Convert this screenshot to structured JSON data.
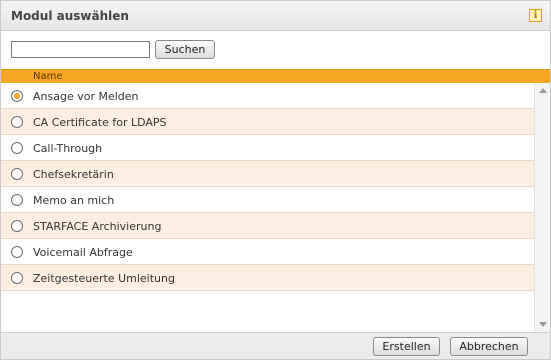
{
  "dialog": {
    "title": "Modul auswählen",
    "info_icon": "info-icon"
  },
  "search": {
    "value": "",
    "placeholder": "",
    "button_label": "Suchen"
  },
  "table": {
    "column_header": "Name",
    "selected_index": 0,
    "items": [
      {
        "label": "Ansage vor Melden",
        "checked": true
      },
      {
        "label": "CA Certificate for LDAPS",
        "checked": false
      },
      {
        "label": "Call-Through",
        "checked": false
      },
      {
        "label": "Chefsekretärin",
        "checked": false
      },
      {
        "label": "Memo an mich",
        "checked": false
      },
      {
        "label": "STARFACE Archivierung",
        "checked": false
      },
      {
        "label": "Voicemail Abfrage",
        "checked": false
      },
      {
        "label": "Zeitgesteuerte Umleitung",
        "checked": false
      }
    ]
  },
  "footer": {
    "create_label": "Erstellen",
    "cancel_label": "Abbrechen"
  },
  "colors": {
    "accent": "#f5a623",
    "row_alt": "#fcefe2"
  }
}
